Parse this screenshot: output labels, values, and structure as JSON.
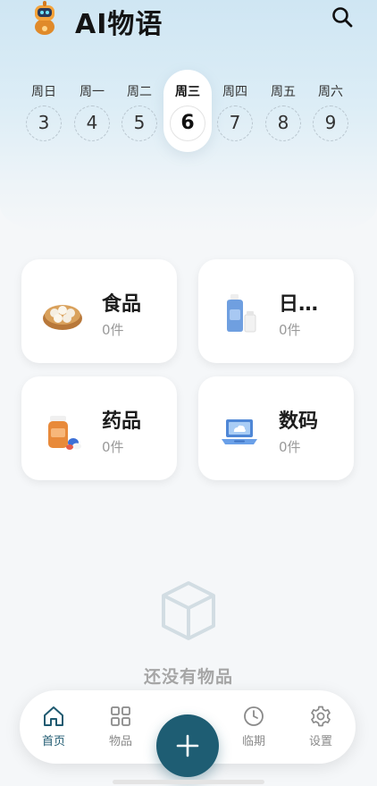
{
  "app": {
    "title": "AI物语"
  },
  "header": {
    "logo_icon": "robot-mascot-icon",
    "search_icon": "search-icon"
  },
  "week": {
    "days": [
      {
        "label": "周日",
        "date": "3",
        "active": false
      },
      {
        "label": "周一",
        "date": "4",
        "active": false
      },
      {
        "label": "周二",
        "date": "5",
        "active": false
      },
      {
        "label": "周三",
        "date": "6",
        "active": true
      },
      {
        "label": "周四",
        "date": "7",
        "active": false
      },
      {
        "label": "周五",
        "date": "8",
        "active": false
      },
      {
        "label": "周六",
        "date": "9",
        "active": false
      }
    ]
  },
  "categories": [
    {
      "name": "食品",
      "count": "0件",
      "icon": "steamed-buns-icon"
    },
    {
      "name": "日…",
      "count": "0件",
      "icon": "detergent-bottle-icon"
    },
    {
      "name": "药品",
      "count": "0件",
      "icon": "medicine-bottle-icon"
    },
    {
      "name": "数码",
      "count": "0件",
      "icon": "laptop-icon"
    }
  ],
  "empty_state": {
    "icon": "box-icon",
    "text": "还没有物品"
  },
  "tabbar": {
    "tabs": [
      {
        "label": "首页",
        "icon": "home-icon",
        "active": true
      },
      {
        "label": "物品",
        "icon": "grid-icon",
        "active": false
      },
      {
        "label": "临期",
        "icon": "clock-icon",
        "active": false
      },
      {
        "label": "设置",
        "icon": "gear-icon",
        "active": false
      }
    ],
    "add_icon": "plus-icon"
  },
  "colors": {
    "accent": "#1e5d73",
    "background": "#f5f7f9",
    "hero": "#cfe6f3"
  }
}
